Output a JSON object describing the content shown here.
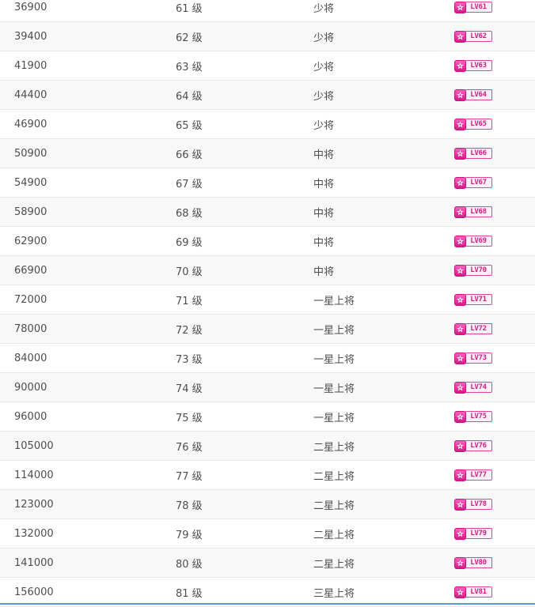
{
  "rows": [
    {
      "exp": "36900",
      "level": "61 级",
      "rank": "少将",
      "badge": "LV61"
    },
    {
      "exp": "39400",
      "level": "62 级",
      "rank": "少将",
      "badge": "LV62"
    },
    {
      "exp": "41900",
      "level": "63 级",
      "rank": "少将",
      "badge": "LV63"
    },
    {
      "exp": "44400",
      "level": "64 级",
      "rank": "少将",
      "badge": "LV64"
    },
    {
      "exp": "46900",
      "level": "65 级",
      "rank": "少将",
      "badge": "LV65"
    },
    {
      "exp": "50900",
      "level": "66 级",
      "rank": "中将",
      "badge": "LV66"
    },
    {
      "exp": "54900",
      "level": "67 级",
      "rank": "中将",
      "badge": "LV67"
    },
    {
      "exp": "58900",
      "level": "68 级",
      "rank": "中将",
      "badge": "LV68"
    },
    {
      "exp": "62900",
      "level": "69 级",
      "rank": "中将",
      "badge": "LV69"
    },
    {
      "exp": "66900",
      "level": "70 级",
      "rank": "中将",
      "badge": "LV70"
    },
    {
      "exp": "72000",
      "level": "71 级",
      "rank": "一星上将",
      "badge": "LV71"
    },
    {
      "exp": "78000",
      "level": "72 级",
      "rank": "一星上将",
      "badge": "LV72"
    },
    {
      "exp": "84000",
      "level": "73 级",
      "rank": "一星上将",
      "badge": "LV73"
    },
    {
      "exp": "90000",
      "level": "74 级",
      "rank": "一星上将",
      "badge": "LV74"
    },
    {
      "exp": "96000",
      "level": "75 级",
      "rank": "一星上将",
      "badge": "LV75"
    },
    {
      "exp": "105000",
      "level": "76 级",
      "rank": "二星上将",
      "badge": "LV76"
    },
    {
      "exp": "114000",
      "level": "77 级",
      "rank": "二星上将",
      "badge": "LV77"
    },
    {
      "exp": "123000",
      "level": "78 级",
      "rank": "二星上将",
      "badge": "LV78"
    },
    {
      "exp": "132000",
      "level": "79 级",
      "rank": "二星上将",
      "badge": "LV79"
    },
    {
      "exp": "141000",
      "level": "80 级",
      "rank": "二星上将",
      "badge": "LV80"
    },
    {
      "exp": "156000",
      "level": "81 级",
      "rank": "三星上将",
      "badge": "LV81"
    }
  ],
  "colors": {
    "badge_accent": "#d11c86",
    "row_alt": "#f8f8f8",
    "divider": "#e8e8e8",
    "bottom_line": "#5b9bd5"
  },
  "icons": {
    "badge": "rank-badge-icon"
  }
}
